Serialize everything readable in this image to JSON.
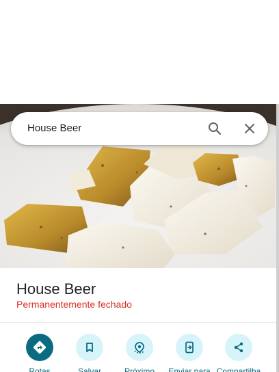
{
  "search": {
    "query": "House Beer"
  },
  "place": {
    "name": "House Beer",
    "status": "Permanentemente fechado"
  },
  "actions": [
    {
      "label": "Rotas",
      "icon": "directions-icon"
    },
    {
      "label": "Salvar",
      "icon": "bookmark-icon"
    },
    {
      "label": "Próximo",
      "icon": "nearby-icon"
    },
    {
      "label": "Enviar para",
      "icon": "send-to-phone-icon"
    },
    {
      "label": "Compartilha",
      "icon": "share-icon"
    }
  ],
  "colors": {
    "accent": "#0b6b80",
    "action_bg": "#d7f4fb",
    "status_red": "#d93025"
  }
}
